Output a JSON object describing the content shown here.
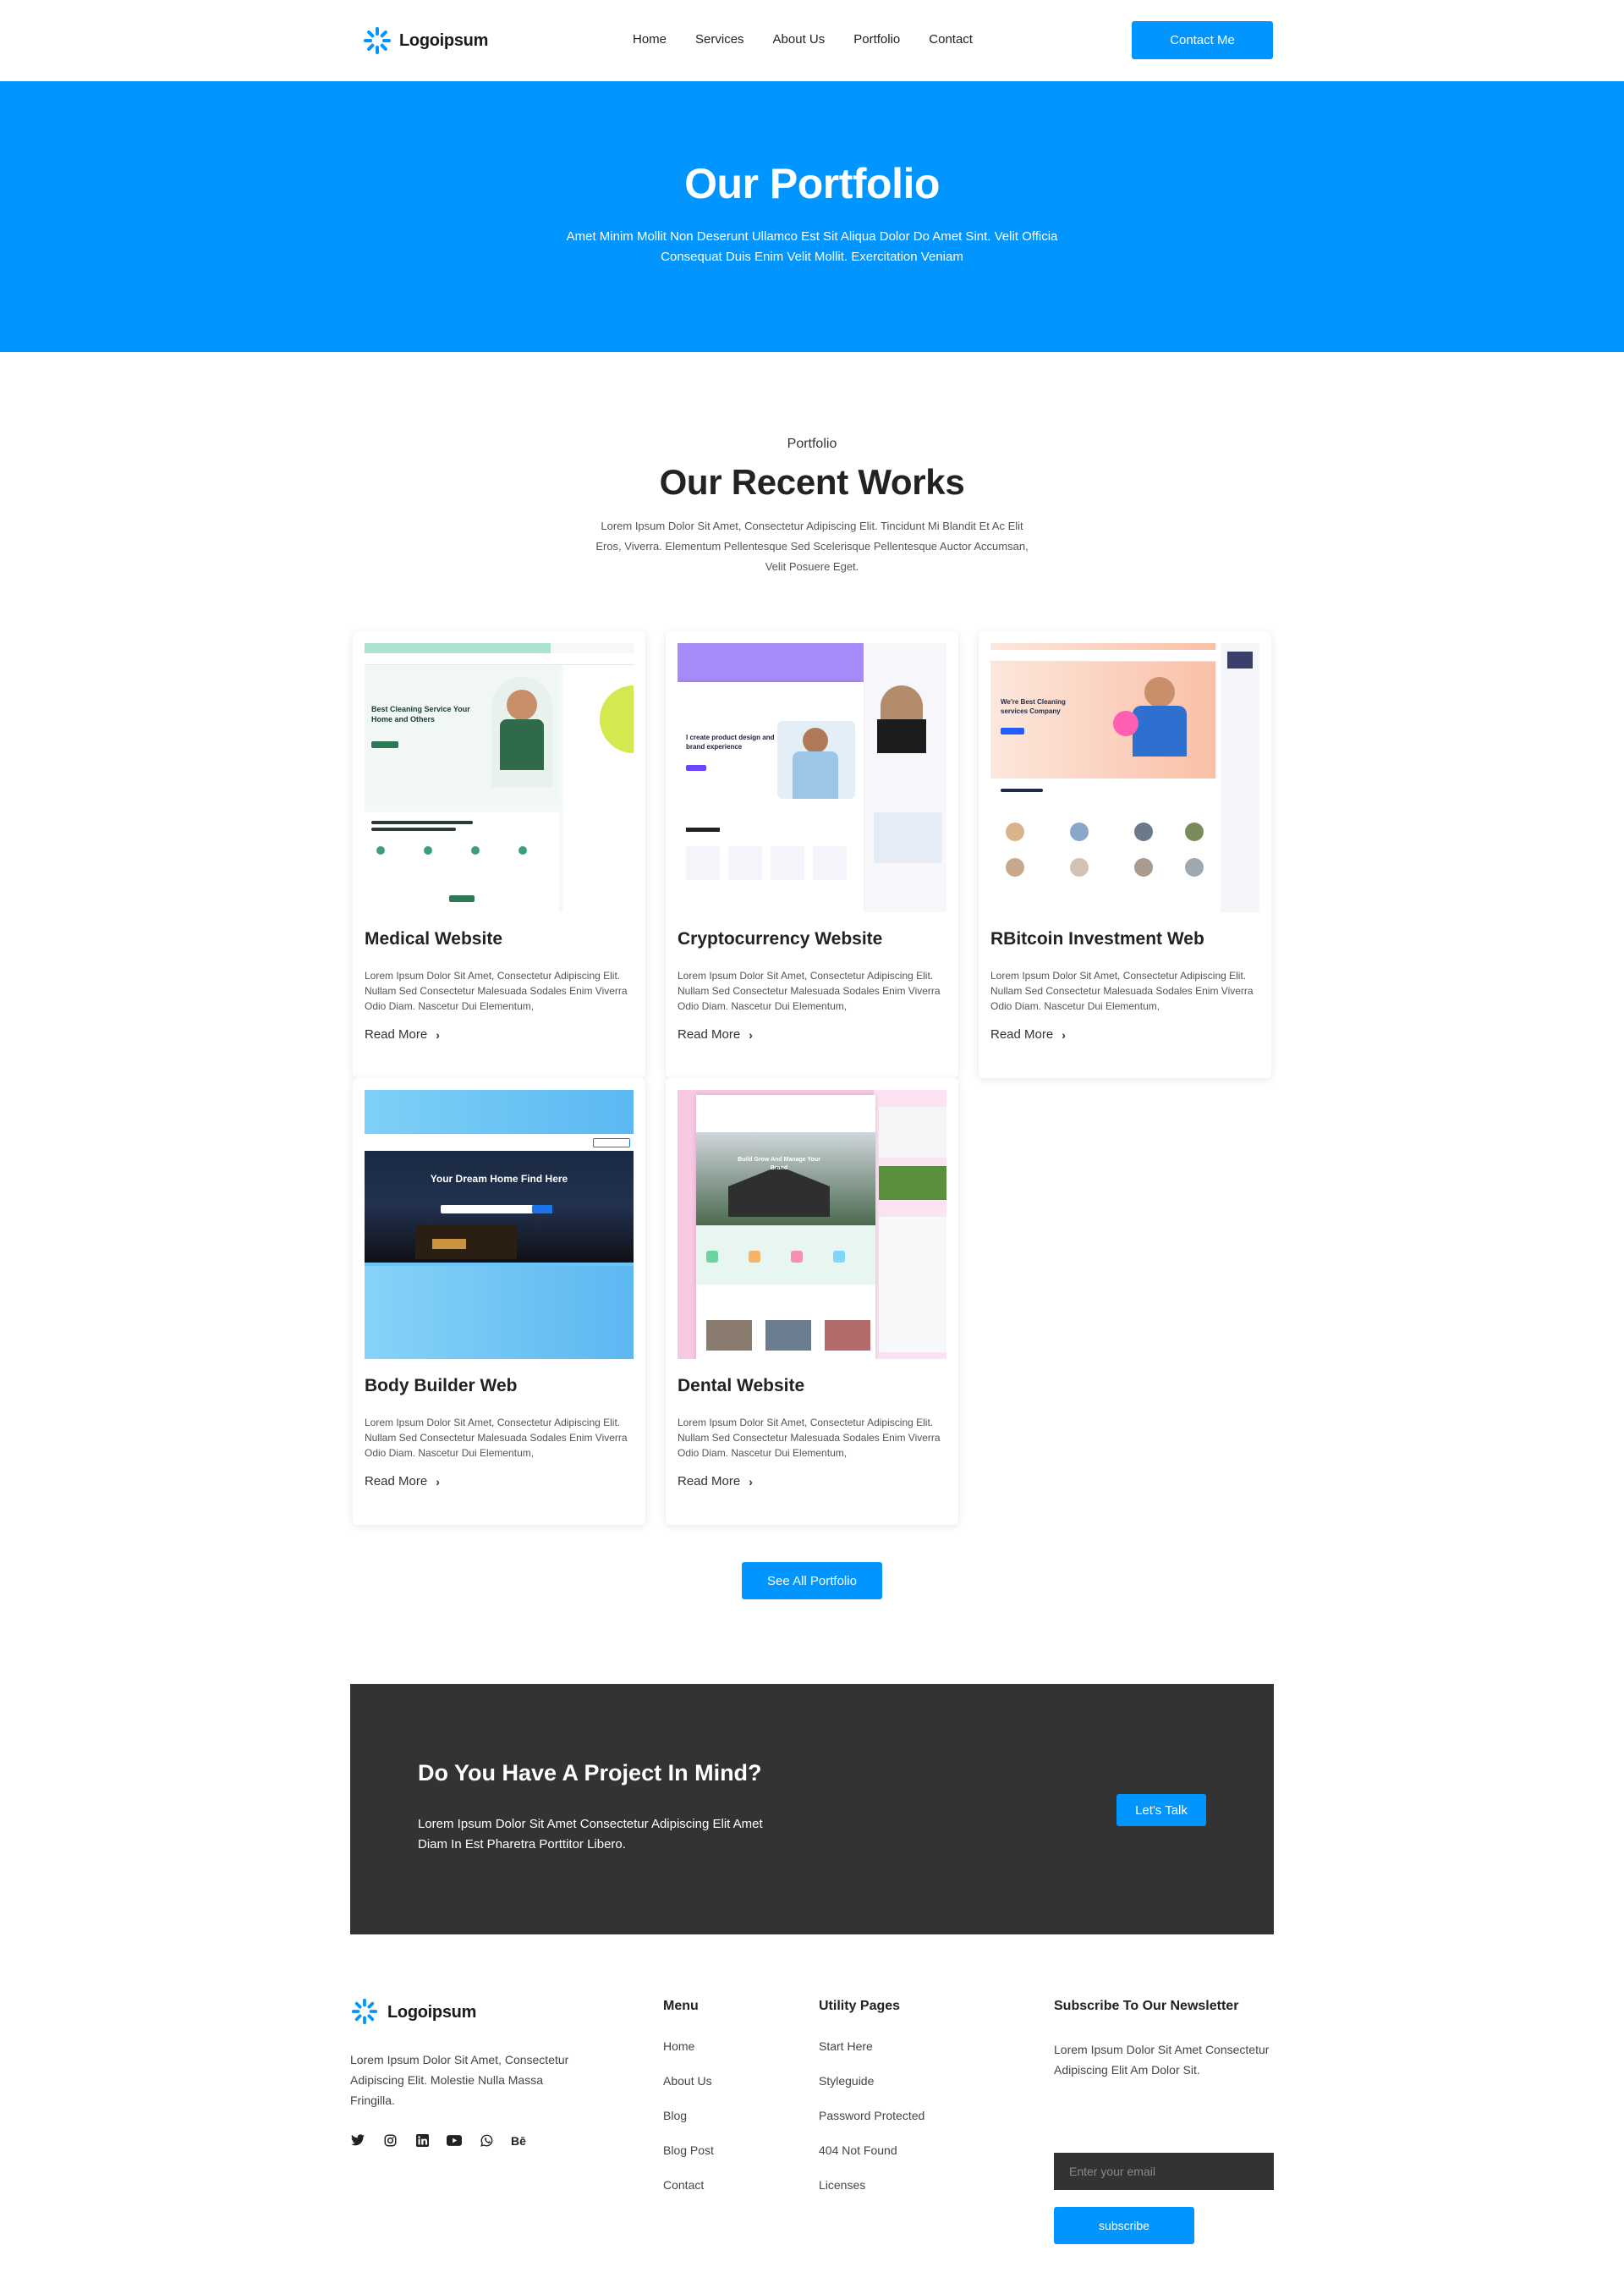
{
  "brand": {
    "name": "Logoipsum",
    "accent": "#0095ff",
    "dark": "#333333"
  },
  "nav": {
    "items": [
      "Home",
      "Services",
      "About Us",
      "Portfolio",
      "Contact"
    ],
    "cta": "Contact Me"
  },
  "hero": {
    "title": "Our Portfolio",
    "subtitle": "Amet Minim Mollit Non Deserunt Ullamco Est Sit Aliqua Dolor Do Amet Sint. Velit Officia Consequat Duis Enim Velit Mollit. Exercitation Veniam"
  },
  "works": {
    "eyebrow": "Portfolio",
    "title": "Our Recent Works",
    "subtitle": "Lorem Ipsum Dolor Sit Amet, Consectetur Adipiscing Elit. Tincidunt Mi Blandit Et Ac Elit Eros, Viverra. Elementum Pellentesque Sed Scelerisque Pellentesque Auctor Accumsan, Velit Posuere Eget.",
    "cards": [
      {
        "title": "Medical Website",
        "desc": "Lorem Ipsum Dolor Sit Amet, Consectetur Adipiscing Elit. Nullam Sed Consectetur Malesuada Sodales Enim Viverra Odio Diam. Nascetur Dui Elementum,",
        "link": "Read More",
        "thumb": "cleaning-service-mockup"
      },
      {
        "title": "Cryptocurrency Website",
        "desc": "Lorem Ipsum Dolor Sit Amet, Consectetur Adipiscing Elit. Nullam Sed Consectetur Malesuada Sodales Enim Viverra Odio Diam. Nascetur Dui Elementum,",
        "link": "Read More",
        "thumb": "product-design-mockup"
      },
      {
        "title": "RBitcoin Investment Web",
        "desc": "Lorem Ipsum Dolor Sit Amet, Consectetur Adipiscing Elit. Nullam Sed Consectetur Malesuada Sodales Enim Viverra Odio Diam. Nascetur Dui Elementum,",
        "link": "Read More",
        "thumb": "cleaning-company-mockup"
      },
      {
        "title": "Body Builder Web",
        "desc": "Lorem Ipsum Dolor Sit Amet, Consectetur Adipiscing Elit. Nullam Sed Consectetur Malesuada Sodales Enim Viverra Odio Diam. Nascetur Dui Elementum,",
        "link": "Read More",
        "thumb": "dream-home-mockup"
      },
      {
        "title": "Dental Website",
        "desc": "Lorem Ipsum Dolor Sit Amet, Consectetur Adipiscing Elit. Nullam Sed Consectetur Malesuada Sodales Enim Viverra Odio Diam. Nascetur Dui Elementum,",
        "link": "Read More",
        "thumb": "real-estate-mockup"
      }
    ],
    "see_all": "See All Portfolio"
  },
  "thumbs": {
    "medical_heading": "Best Cleaning Service Your Home and Others",
    "crypto_heading": "I create product design and brand experience",
    "rbitcoin_heading": "We're Best Cleaning services Company",
    "body_heading": "Your Dream Home Find Here",
    "dental_heading": "Build Grow And Manage Your Brand"
  },
  "cta": {
    "title": "Do You Have A Project In Mind?",
    "text": "Lorem Ipsum Dolor Sit Amet Consectetur Adipiscing Elit Amet Diam In Est Pharetra Porttitor Libero.",
    "button": "Let's Talk"
  },
  "footer": {
    "desc": "Lorem Ipsum Dolor Sit Amet, Consectetur Adipiscing Elit. Molestie Nulla Massa Fringilla.",
    "social": [
      "twitter-icon",
      "instagram-icon",
      "linkedin-icon",
      "youtube-icon",
      "whatsapp-icon",
      "behance-icon"
    ],
    "menu": {
      "title": "Menu",
      "items": [
        "Home",
        "About Us",
        "Blog",
        "Blog Post",
        "Contact"
      ]
    },
    "utility": {
      "title": "Utility Pages",
      "items": [
        "Start Here",
        "Styleguide",
        "Password Protected",
        "404 Not Found",
        "Licenses"
      ]
    },
    "newsletter": {
      "title": "Subscribe To Our Newsletter",
      "text": "Lorem Ipsum Dolor Sit Amet Consectetur Adipiscing Elit Am Dolor Sit.",
      "placeholder": "Enter your email",
      "button": "subscribe"
    }
  }
}
